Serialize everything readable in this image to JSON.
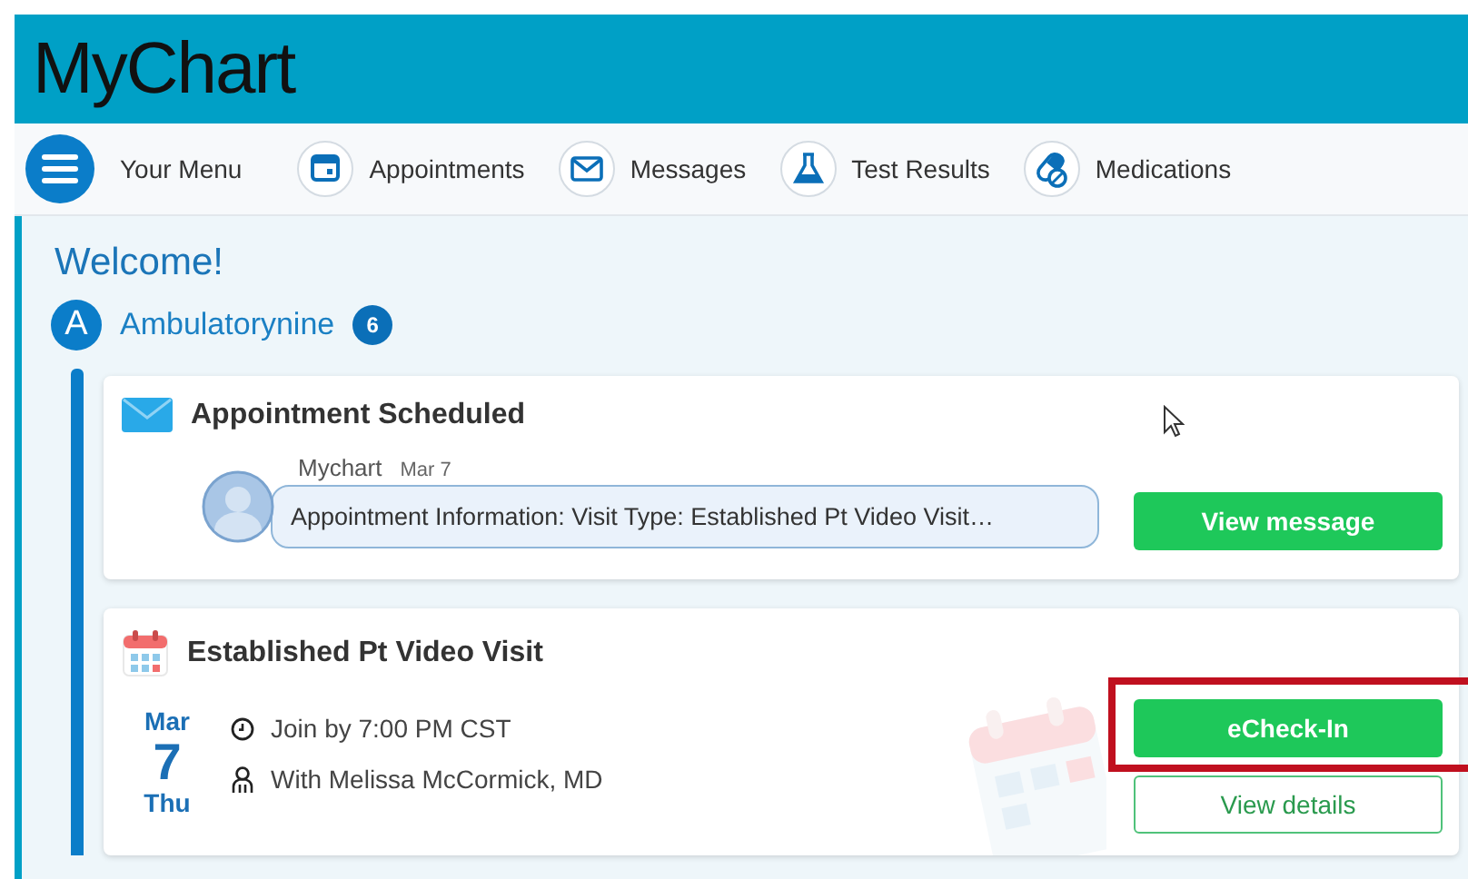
{
  "header": {
    "logo": "MyChart"
  },
  "nav": [
    {
      "label": "Your Menu",
      "kind": "menu"
    },
    {
      "label": "Appointments",
      "kind": "calendar"
    },
    {
      "label": "Messages",
      "kind": "envelope"
    },
    {
      "label": "Test Results",
      "kind": "flask"
    },
    {
      "label": "Medications",
      "kind": "pills"
    }
  ],
  "welcome": "Welcome!",
  "patient": {
    "initial": "A",
    "name": "Ambulatorynine",
    "badge": "6"
  },
  "message_card": {
    "title": "Appointment Scheduled",
    "sender": "Mychart",
    "date": "Mar 7",
    "preview": "Appointment Information: Visit Type: Established Pt Video Visit…",
    "button": "View message"
  },
  "visit_card": {
    "title": "Established Pt Video Visit",
    "month": "Mar",
    "day": "7",
    "weekday": "Thu",
    "time": "Join by 7:00 PM CST",
    "provider": "With Melissa McCormick, MD",
    "buttons": [
      {
        "label": "eCheck-In",
        "kind": "primary",
        "highlighted": true
      },
      {
        "label": "View details",
        "kind": "secondary",
        "highlighted": false
      }
    ]
  }
}
